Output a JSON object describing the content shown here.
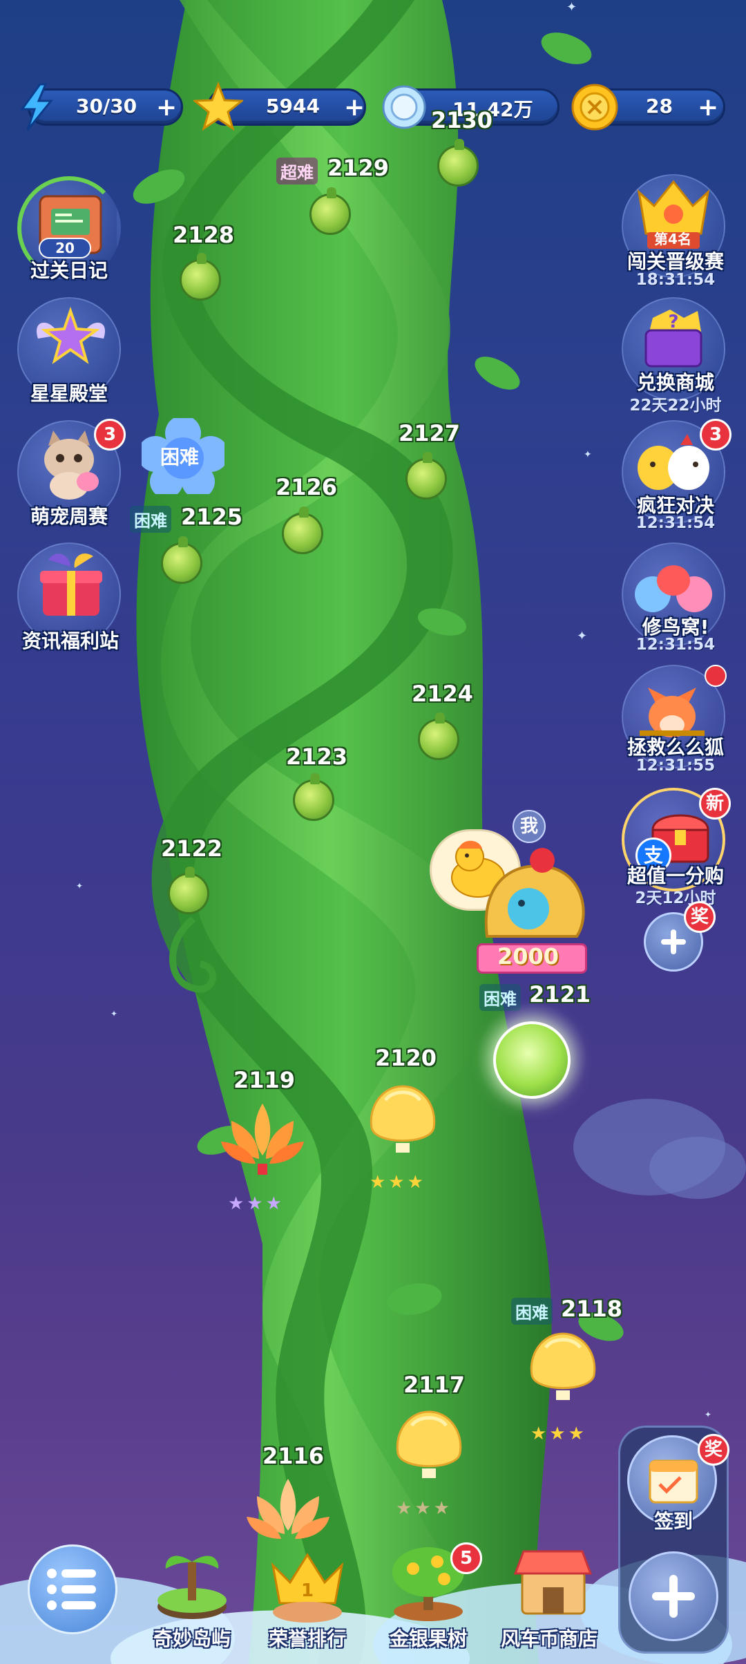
{
  "top_bar": {
    "energy": "30/30",
    "stars": "5944",
    "gems": "11.42万",
    "coins": "28",
    "plus": "+"
  },
  "left_menu": [
    {
      "label": "过关日记",
      "sub": "20"
    },
    {
      "label": "星星殿堂"
    },
    {
      "label": "萌宠周赛",
      "badge": "3"
    },
    {
      "label": "资讯福利站"
    }
  ],
  "right_menu": [
    {
      "label": "闯关晋级赛",
      "timer": "18:31:54",
      "rank": "第4名"
    },
    {
      "label": "兑换商城",
      "timer": "22天22小时"
    },
    {
      "label": "疯狂对决",
      "timer": "12:31:54",
      "badge": "3"
    },
    {
      "label": "修鸟窝!",
      "timer": "12:31:54"
    },
    {
      "label": "拯救么么狐",
      "timer": "12:31:55"
    },
    {
      "label": "超值一分购",
      "timer": "2天12小时",
      "badge": "新",
      "icon_text": "支"
    }
  ],
  "reward_tag": "奖",
  "levels": {
    "l2130": "2130",
    "l2129": "2129",
    "l2128": "2128",
    "l2127": "2127",
    "l2126": "2126",
    "l2125": "2125",
    "l2124": "2124",
    "l2123": "2123",
    "l2122": "2122",
    "l2121": "2121",
    "l2120": "2120",
    "l2119": "2119",
    "l2118": "2118",
    "l2117": "2117",
    "l2116": "2116"
  },
  "difficulty": {
    "hard": "困难",
    "super_hard": "超难"
  },
  "hard_flower": "困难",
  "player": {
    "me_tag": "我",
    "score": "2000"
  },
  "signin": {
    "label": "签到",
    "badge": "奖"
  },
  "bottom_nav": [
    {
      "label": "奇妙岛屿"
    },
    {
      "label": "荣誉排行"
    },
    {
      "label": "金银果树",
      "badge": "5"
    },
    {
      "label": "风车币商店"
    }
  ],
  "colors": {
    "stalk": "#3fae3a",
    "bg_top": "#1e3f86",
    "bg_bottom": "#6b4a98"
  }
}
